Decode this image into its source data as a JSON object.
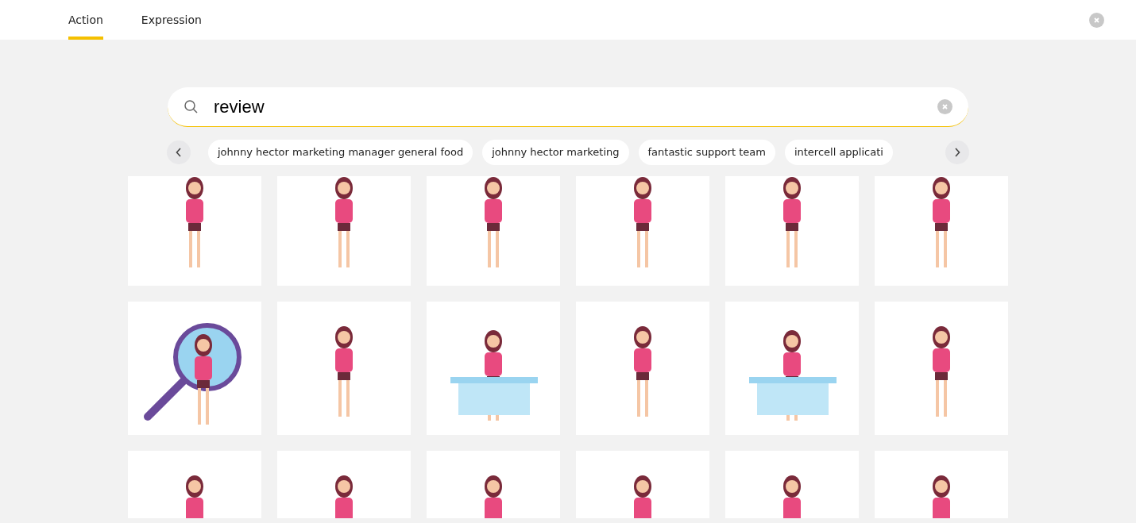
{
  "tabs": [
    {
      "label": "Action",
      "selected": true
    },
    {
      "label": "Expression",
      "selected": false
    }
  ],
  "search": {
    "value": "review"
  },
  "suggestions": [
    "johnny hector marketing manager general food",
    "johnny hector marketing",
    "fantastic support team",
    "intercell applicati"
  ],
  "results": [
    {
      "kind": "character"
    },
    {
      "kind": "character"
    },
    {
      "kind": "character"
    },
    {
      "kind": "character"
    },
    {
      "kind": "character"
    },
    {
      "kind": "character"
    },
    {
      "kind": "magnifier"
    },
    {
      "kind": "character"
    },
    {
      "kind": "desk"
    },
    {
      "kind": "character"
    },
    {
      "kind": "desk"
    },
    {
      "kind": "character"
    },
    {
      "kind": "character"
    },
    {
      "kind": "character"
    },
    {
      "kind": "character"
    },
    {
      "kind": "character"
    },
    {
      "kind": "character"
    },
    {
      "kind": "character"
    }
  ]
}
